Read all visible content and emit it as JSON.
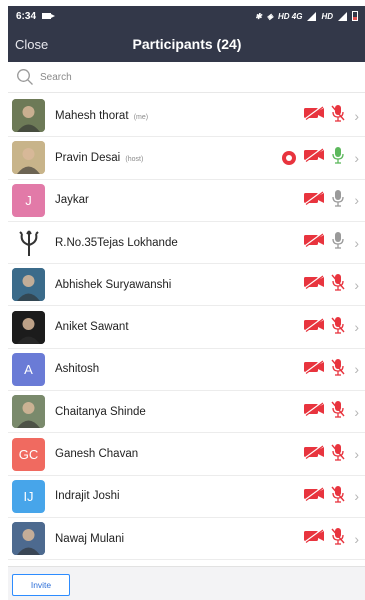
{
  "status_bar": {
    "time": "6:34",
    "network_label": "HD 4G",
    "network_label_2": "HD"
  },
  "header": {
    "close_label": "Close",
    "title": "Participants (24)"
  },
  "search": {
    "placeholder": "Search"
  },
  "participants": [
    {
      "name": "Mahesh thorat",
      "role": "(me)",
      "avatar": "photo",
      "avatar_color": "#6d7a57",
      "video": "muted",
      "audio": "muted",
      "recording": false
    },
    {
      "name": "Pravin Desai",
      "role": "(host)",
      "avatar": "photo",
      "avatar_color": "#c8b48a",
      "video": "muted",
      "audio": "speaking",
      "recording": true
    },
    {
      "name": "Jaykar",
      "role": "",
      "avatar_initials": "J",
      "avatar_color": "#e27aa8",
      "video": "muted",
      "audio": "unmuted",
      "recording": false
    },
    {
      "name": "R.No.35Tejas Lokhande",
      "role": "",
      "avatar": "trident-logo",
      "avatar_color": "#ffffff",
      "video": "muted",
      "audio": "unmuted",
      "recording": false
    },
    {
      "name": "Abhishek Suryawanshi",
      "role": "",
      "avatar": "photo",
      "avatar_color": "#3b6b8a",
      "video": "muted",
      "audio": "muted",
      "recording": false
    },
    {
      "name": "Aniket Sawant",
      "role": "",
      "avatar": "photo",
      "avatar_color": "#1c1c1c",
      "video": "muted",
      "audio": "muted",
      "recording": false
    },
    {
      "name": "Ashitosh",
      "role": "",
      "avatar_initials": "A",
      "avatar_color": "#6a7bd6",
      "video": "muted",
      "audio": "muted",
      "recording": false
    },
    {
      "name": "Chaitanya Shinde",
      "role": "",
      "avatar": "photo",
      "avatar_color": "#7a8a6c",
      "video": "muted",
      "audio": "muted",
      "recording": false
    },
    {
      "name": "Ganesh Chavan",
      "role": "",
      "avatar_initials": "GC",
      "avatar_color": "#f06a60",
      "video": "muted",
      "audio": "muted",
      "recording": false
    },
    {
      "name": "Indrajit Joshi",
      "role": "",
      "avatar_initials": "IJ",
      "avatar_color": "#47a5ea",
      "video": "muted",
      "audio": "muted",
      "recording": false
    },
    {
      "name": "Nawaj Mulani",
      "role": "",
      "avatar": "photo",
      "avatar_color": "#4d6a8f",
      "video": "muted",
      "audio": "muted",
      "recording": false
    }
  ],
  "footer": {
    "invite_label": "Invite"
  },
  "colors": {
    "header_bg": "#333849",
    "muted_red": "#e8343e",
    "speaking_green": "#5cb85c",
    "unmuted_gray": "#9a9a9a",
    "accent_blue": "#2d8cff"
  }
}
